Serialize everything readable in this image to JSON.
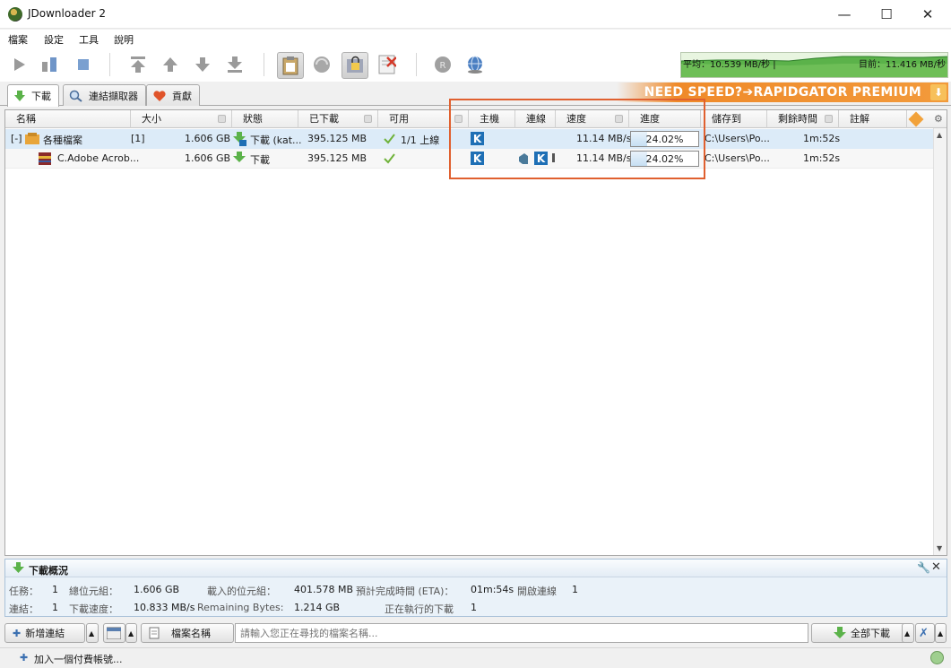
{
  "window": {
    "title": "JDownloader 2",
    "minimize": "—",
    "maximize": "☐",
    "close": "✕"
  },
  "menu": [
    "檔案",
    "設定",
    "工具",
    "說明"
  ],
  "graph": {
    "avg": "平均：10.539 MB/秒 |",
    "current": "目前：11.416 MB/秒"
  },
  "tabs": [
    {
      "label": "下載",
      "icon": "download-arrow-icon",
      "active": true
    },
    {
      "label": "連結擷取器",
      "icon": "magnifier-icon",
      "active": false
    },
    {
      "label": "貢獻",
      "icon": "heart-icon",
      "active": false
    }
  ],
  "promo": "NEED SPEED?➔RAPIDGATOR PREMIUM",
  "columns": [
    "名稱",
    "大小",
    "狀態",
    "已下載",
    "可用",
    "主機",
    "連線",
    "速度",
    "進度",
    "儲存到",
    "剩餘時間",
    "註解"
  ],
  "rows": [
    {
      "expander": "[-]",
      "name": "各種檔案",
      "count": "[1]",
      "size": "1.606 GB",
      "status": "下載 (kat...",
      "downloaded": "395.125 MB",
      "available": "1/1 上線",
      "host": "K",
      "connections": "",
      "speed": "11.14 MB/s",
      "progress": "24.02%",
      "progress_value": 0.2402,
      "save_to": "C:\\Users\\Po...",
      "eta": "1m:52s",
      "comment": ""
    },
    {
      "expander": "",
      "name": "C.Adobe Acrob...",
      "count": "",
      "size": "1.606 GB",
      "status": "下載",
      "downloaded": "395.125 MB",
      "available": "",
      "host": "K",
      "connections": "K",
      "speed": "11.14 MB/s",
      "progress": "24.02%",
      "progress_value": 0.2402,
      "save_to": "C:\\Users\\Po...",
      "eta": "1m:52s",
      "comment": ""
    }
  ],
  "summary": {
    "title": "下載概況",
    "tasks_label": "任務：",
    "tasks": "1",
    "total_label": "總位元組：",
    "total": "1.606 GB",
    "loaded_label": "載入的位元組：",
    "loaded": "401.578 MB",
    "eta_label": "預計完成時間 (ETA)：",
    "eta": "01m:54s",
    "open_conn_label": "開啟連線",
    "open_conn": "1",
    "links_label": "連結：",
    "links": "1",
    "speed_label": "下載速度：",
    "speed": "10.833 MB/s",
    "remaining_label": "Remaining Bytes:",
    "remaining": "1.214 GB",
    "running_label": "正在執行的下載",
    "running": "1"
  },
  "bottom": {
    "add_links": "新增連結",
    "filter_label": "檔案名稱",
    "search_placeholder": "請輸入您正在尋找的檔案名稱...",
    "start_all": "全部下載",
    "add_premium": "加入一個付費帳號..."
  },
  "colors": {
    "accent": "#1e6fb5",
    "highlight": "#e0602f",
    "promo": "#ef8a2a",
    "graph": "#3e9a3a"
  }
}
